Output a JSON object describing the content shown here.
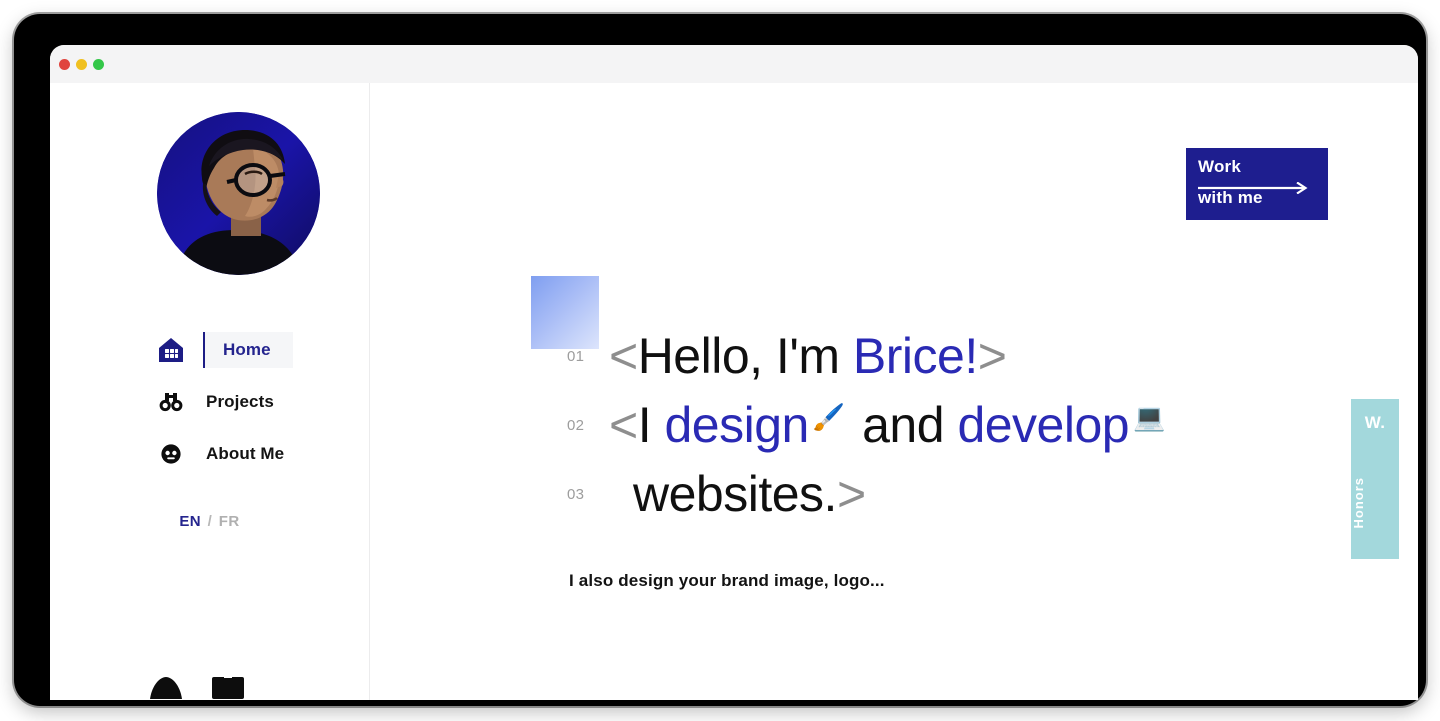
{
  "window": {
    "traffic_lights": [
      {
        "name": "close",
        "color": "#e0443e"
      },
      {
        "name": "minimize",
        "color": "#f0c020"
      },
      {
        "name": "maximize",
        "color": "#34c749"
      }
    ]
  },
  "theme": {
    "navy": "#1e1e8f",
    "accent_text": "#2a2ab4",
    "bracket_gray": "#8e8e8e",
    "line_number_gray": "#9d9d9d",
    "teal": "#a3d8dc",
    "square_gradient_from": "#7f9ef0",
    "square_gradient_to": "#dde5fc",
    "avatar_bg": "#130f8c"
  },
  "sidebar": {
    "avatar": {
      "icon": "avatar-portrait-photo",
      "alt": "Portrait photo of Brice on navy background"
    },
    "nav": [
      {
        "id": "home",
        "label": "Home",
        "icon": "house-icon",
        "active": true
      },
      {
        "id": "projects",
        "label": "Projects",
        "icon": "binoculars-icon",
        "active": false
      },
      {
        "id": "about",
        "label": "About Me",
        "icon": "face-icon",
        "active": false
      }
    ],
    "language": {
      "active": "EN",
      "separator": "/",
      "inactive": "FR"
    },
    "socials": [
      {
        "id": "social-1",
        "icon": "social-link-icon"
      },
      {
        "id": "social-2",
        "icon": "social-link-icon"
      }
    ]
  },
  "main": {
    "cta": {
      "line_top": "Work",
      "line_bottom": "with me",
      "arrow_icon": "arrow-right-icon"
    },
    "accent_square": {
      "icon": "decorative-gradient-square"
    },
    "headline": [
      {
        "number": "01",
        "segments": [
          {
            "text": "<",
            "style": "bracket"
          },
          {
            "text": "Hello, I'm ",
            "style": "plain"
          },
          {
            "text": "Brice!",
            "style": "accent"
          },
          {
            "text": ">",
            "style": "bracket"
          }
        ]
      },
      {
        "number": "02",
        "segments": [
          {
            "text": "<",
            "style": "bracket"
          },
          {
            "text": "I ",
            "style": "plain"
          },
          {
            "text": "design",
            "style": "accent"
          },
          {
            "text": "🖌️",
            "style": "emoji",
            "icon": "paintbrush-emoji"
          },
          {
            "text": " and ",
            "style": "plain"
          },
          {
            "text": "develop",
            "style": "accent"
          },
          {
            "text": "💻",
            "style": "emoji",
            "icon": "laptop-emoji"
          }
        ]
      },
      {
        "number": "03",
        "segments": [
          {
            "text": "websites.",
            "style": "plain"
          },
          {
            "text": ">",
            "style": "bracket"
          }
        ]
      }
    ],
    "subtitle": "I also design your brand image, logo...",
    "honors_tab": {
      "mark": "W.",
      "label": "Honors"
    }
  }
}
